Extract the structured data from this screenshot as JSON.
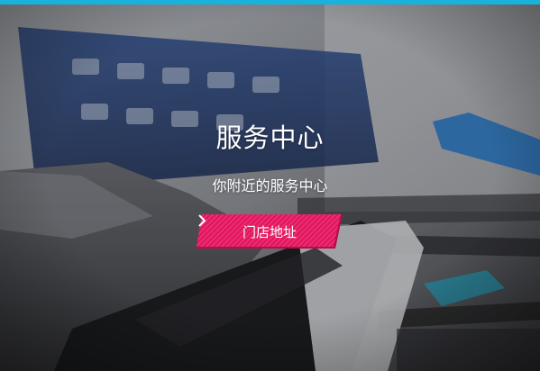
{
  "hero": {
    "title": "服务中心",
    "subtitle": "你附近的服务中心",
    "cta_label": "门店地址"
  },
  "colors": {
    "top_bar": "#17b3dc",
    "cta": "#e3135d",
    "cta_shadow": "#b50d47"
  },
  "icons": {
    "cta_arrow": "chevron-right-icon"
  }
}
